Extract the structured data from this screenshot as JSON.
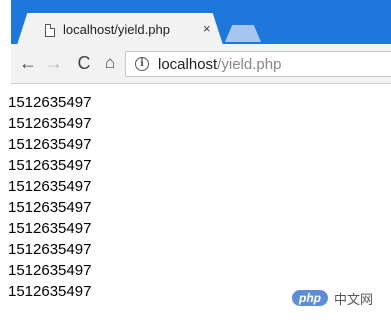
{
  "tab": {
    "title": "localhost/yield.php",
    "close_glyph": "×",
    "favicon": "page-icon"
  },
  "toolbar": {
    "back_glyph": "←",
    "forward_glyph": "→",
    "reload_glyph": "C",
    "home_glyph": "⌂",
    "info_glyph": "i"
  },
  "address_bar": {
    "host": "localhost",
    "path": "/yield.php"
  },
  "output_lines": [
    "1512635497",
    "1512635497",
    "1512635497",
    "1512635497",
    "1512635497",
    "1512635497",
    "1512635497",
    "1512635497",
    "1512635497",
    "1512635497"
  ],
  "watermark": {
    "badge": "php",
    "text": "中文网"
  }
}
